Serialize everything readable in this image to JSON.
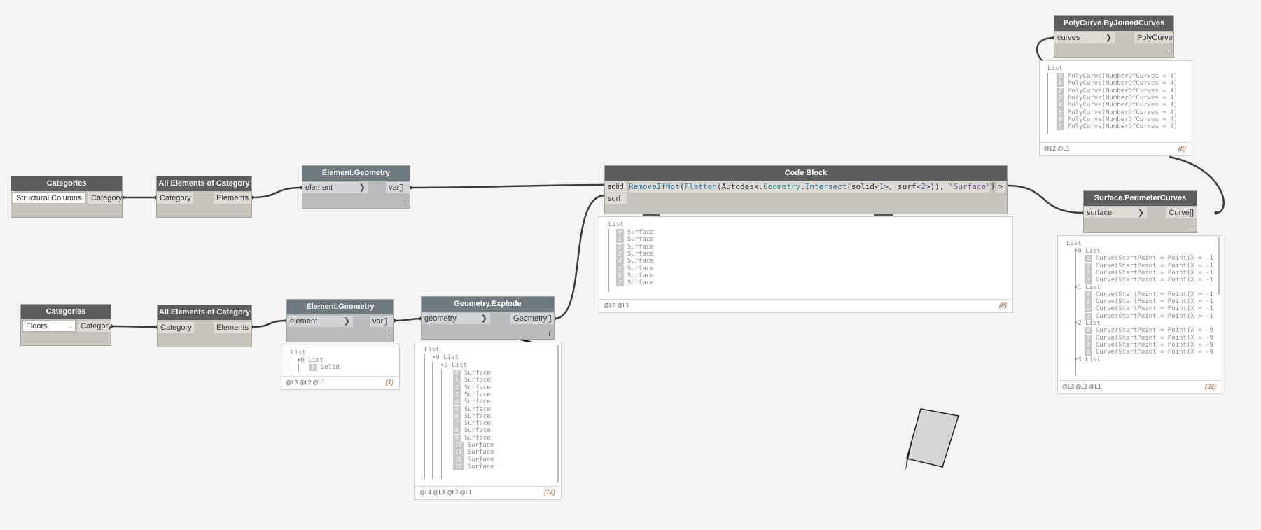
{
  "nodes": {
    "categories_1": {
      "title": "Categories",
      "dropdown": "Structural Columns",
      "output": "Category"
    },
    "all_elements_1": {
      "title": "All Elements of Category",
      "input": "Category",
      "output": "Elements"
    },
    "element_geometry_1": {
      "title": "Element.Geometry",
      "input": "element",
      "output": "var[]"
    },
    "categories_2": {
      "title": "Categories",
      "dropdown": "Floors",
      "output": "Category"
    },
    "all_elements_2": {
      "title": "All Elements of Category",
      "input": "Category",
      "output": "Elements"
    },
    "element_geometry_2": {
      "title": "Element.Geometry",
      "input": "element",
      "output": "var[]"
    },
    "geometry_explode": {
      "title": "Geometry.Explode",
      "input": "geometry",
      "output": "Geometry[]"
    },
    "code_block": {
      "title": "Code Block",
      "input1": "solid",
      "input2": "surf",
      "output": ">",
      "code": {
        "p1": "RemoveIfNot",
        "p2": "(",
        "p3": "Flatten",
        "p4": "(Autodesk.",
        "p5": "Geometry",
        "p6": ".",
        "p7": "Intersect",
        "p8": "(solid<",
        "p9": "1",
        "p10": ">, surf<",
        "p11": "2",
        "p12": ">)), ",
        "p13": "\"Surface\"",
        "p14": ");"
      }
    },
    "perimeter_curves": {
      "title": "Surface.PerimeterCurves",
      "input": "surface",
      "output": "Curve[]"
    },
    "polycurve": {
      "title": "PolyCurve.ByJoinedCurves",
      "input": "curves",
      "output": "PolyCurve"
    }
  },
  "previews": {
    "polycurve": {
      "root": "List",
      "items": [
        "PolyCurve(NumberOfCurves = 4)",
        "PolyCurve(NumberOfCurves = 4)",
        "PolyCurve(NumberOfCurves = 4)",
        "PolyCurve(NumberOfCurves = 4)",
        "PolyCurve(NumberOfCurves = 4)",
        "PolyCurve(NumberOfCurves = 4)",
        "PolyCurve(NumberOfCurves = 4)",
        "PolyCurve(NumberOfCurves = 4)"
      ],
      "indices": [
        "0",
        "1",
        "2",
        "3",
        "4",
        "5",
        "6",
        "7"
      ],
      "levels": "@L2 @L1",
      "count": "{8}"
    },
    "code_block": {
      "root": "List",
      "items": [
        "Surface",
        "Surface",
        "Surface",
        "Surface",
        "Surface",
        "Surface",
        "Surface",
        "Surface"
      ],
      "indices": [
        "0",
        "1",
        "2",
        "3",
        "4",
        "5",
        "6",
        "7"
      ],
      "levels": "@L2 @L1",
      "count": "{8}"
    },
    "element_geometry_2": {
      "root": "List",
      "sub": "0 List",
      "item": "Solid",
      "index": "0",
      "levels": "@L3 @L2 @L1",
      "count": "{1}"
    },
    "geometry_explode": {
      "root": "List",
      "sub1": "0 List",
      "sub2": "0 List",
      "items": [
        "Surface",
        "Surface",
        "Surface",
        "Surface",
        "Surface",
        "Surface",
        "Surface",
        "Surface",
        "Surface",
        "Surface",
        "Surface",
        "Surface",
        "Surface",
        "Surface"
      ],
      "indices": [
        "0",
        "1",
        "2",
        "3",
        "4",
        "5",
        "6",
        "7",
        "8",
        "9",
        "10",
        "11",
        "12",
        "13"
      ],
      "levels": "@L4 @L3 @L2 @L1",
      "count": "{14}"
    },
    "perimeter_curves": {
      "root": "List",
      "groups": [
        {
          "label": "0 List",
          "items": [
            "Curve(StartPoint = Point(X = -1",
            "Curve(StartPoint = Point(X = -1",
            "Curve(StartPoint = Point(X = -1",
            "Curve(StartPoint = Point(X = -1"
          ]
        },
        {
          "label": "1 List",
          "items": [
            "Curve(StartPoint = Point(X = -1",
            "Curve(StartPoint = Point(X = -1",
            "Curve(StartPoint = Point(X = -1",
            "Curve(StartPoint = Point(X = -1"
          ]
        },
        {
          "label": "2 List",
          "items": [
            "Curve(StartPoint = Point(X = -9",
            "Curve(StartPoint = Point(X = -9",
            "Curve(StartPoint = Point(X = -9",
            "Curve(StartPoint = Point(X = -9"
          ]
        },
        {
          "label": "3 List",
          "items": []
        }
      ],
      "indices": [
        "0",
        "1",
        "2",
        "3"
      ],
      "levels": "@L3 @L2 @L1",
      "count": "{32}"
    }
  },
  "colors": {
    "wire": "#3c3c3c",
    "canvas": "#f4f4f4",
    "header_dark": "#5d5d5d",
    "header_grey": "#6f7a80",
    "node_body": "#c8c4bc"
  }
}
